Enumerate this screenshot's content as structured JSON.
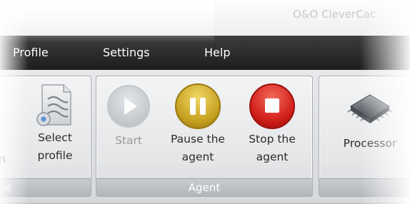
{
  "window": {
    "title": "O&O CleverCac"
  },
  "menu": {
    "items": [
      {
        "label": "Profile"
      },
      {
        "label": "Settings"
      },
      {
        "label": "Help"
      }
    ]
  },
  "ribbon": {
    "groups": [
      {
        "label": "ne",
        "buttons": [
          {
            "label_line1": "Select",
            "label_line2": "profile",
            "icon": "profile-document-icon",
            "enabled": true
          },
          {
            "label_line1": "",
            "label_line2": "n",
            "icon": "",
            "enabled": true
          }
        ]
      },
      {
        "label": "Agent",
        "buttons": [
          {
            "label_line1": "Start",
            "label_line2": "",
            "icon": "play-icon",
            "enabled": false
          },
          {
            "label_line1": "Pause the",
            "label_line2": "agent",
            "icon": "pause-icon",
            "enabled": true
          },
          {
            "label_line1": "Stop the",
            "label_line2": "agent",
            "icon": "stop-icon",
            "enabled": true
          }
        ]
      },
      {
        "label": "",
        "buttons": [
          {
            "label_line1": "Processor",
            "label_line2": "",
            "icon": "processor-chip-icon",
            "enabled": true
          }
        ]
      }
    ]
  },
  "colors": {
    "menubar": "#2a2a2a",
    "pause": "#c6a01f",
    "stop": "#d01c17",
    "start_disabled": "#c3c7cc"
  }
}
